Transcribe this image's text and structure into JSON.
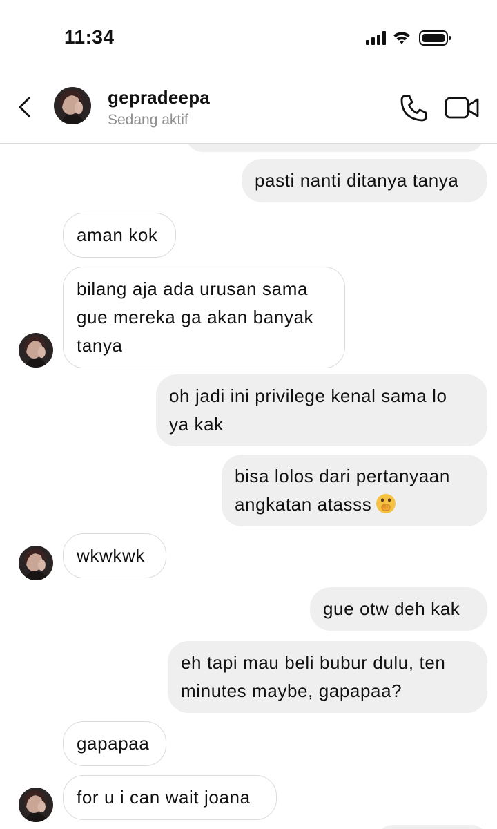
{
  "status_bar": {
    "time": "11:34"
  },
  "header": {
    "username": "gepradeepa",
    "status": "Sedang aktif"
  },
  "messages": [
    {
      "side": "sent",
      "text": "pasti nanti ditanya tanya"
    },
    {
      "side": "received",
      "text": "aman kok"
    },
    {
      "side": "received",
      "text": "bilang aja ada urusan sama\ngue mereka ga akan banyak\ntanya"
    },
    {
      "side": "sent",
      "text": "oh jadi ini privilege kenal sama lo\nya kak"
    },
    {
      "side": "sent",
      "text": "bisa lolos dari pertanyaan\nangkatan atasss"
    },
    {
      "side": "received",
      "text": "wkwkwk"
    },
    {
      "side": "sent",
      "text": "gue otw deh kak"
    },
    {
      "side": "sent",
      "text": "eh tapi mau beli bubur dulu, ten\nminutes maybe, gapapaa?"
    },
    {
      "side": "received",
      "text": "gapapaa"
    },
    {
      "side": "received",
      "text": "for u i can wait joana"
    }
  ],
  "colors": {
    "sent_bubble": "#efefef",
    "received_border": "#dbdbdb",
    "muted_text": "#8e8e8e"
  },
  "icons": [
    "back-chevron-icon",
    "phone-icon",
    "video-camera-icon",
    "signal-icon",
    "wifi-icon",
    "battery-icon",
    "shushing-face-emoji"
  ]
}
